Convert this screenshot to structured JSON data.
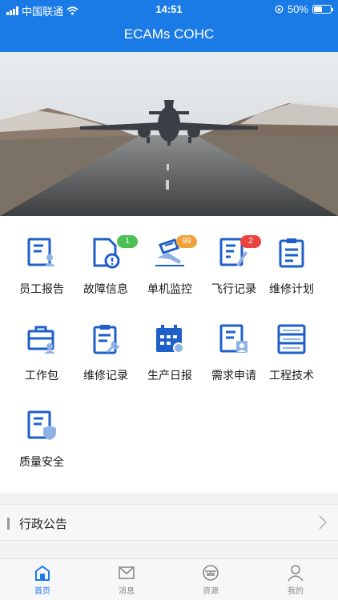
{
  "status_bar": {
    "carrier": "中国联通",
    "time": "14:51",
    "battery": "50%",
    "battery_level": 0.5
  },
  "header": {
    "title": "ECAMs COHC"
  },
  "colors": {
    "primary": "#1b7be6",
    "icon": "#1f5fc9",
    "badge_green": "#4cbf55",
    "badge_orange": "#f0a23b",
    "badge_red": "#e9443f"
  },
  "menu": [
    {
      "label": "员工报告",
      "icon": "staff-report-icon"
    },
    {
      "label": "故障信息",
      "icon": "fault-info-icon",
      "badge": "1"
    },
    {
      "label": "单机监控",
      "icon": "aircraft-monitor-icon",
      "badge": "99"
    },
    {
      "label": "飞行记录",
      "icon": "flight-record-icon",
      "badge": "2"
    },
    {
      "label": "维修计划",
      "icon": "maintenance-plan-icon"
    },
    {
      "label": "工作包",
      "icon": "work-package-icon"
    },
    {
      "label": "维修记录",
      "icon": "maintenance-record-icon"
    },
    {
      "label": "生产日报",
      "icon": "production-daily-icon"
    },
    {
      "label": "需求申请",
      "icon": "demand-request-icon"
    },
    {
      "label": "工程技术",
      "icon": "engineering-icon"
    },
    {
      "label": "质量安全",
      "icon": "quality-safety-icon"
    }
  ],
  "notice": {
    "label": "行政公告"
  },
  "tabs": [
    {
      "label": "首页",
      "icon": "home-icon"
    },
    {
      "label": "消息",
      "icon": "mail-icon"
    },
    {
      "label": "资源",
      "icon": "resource-icon"
    },
    {
      "label": "我的",
      "icon": "user-icon"
    }
  ]
}
